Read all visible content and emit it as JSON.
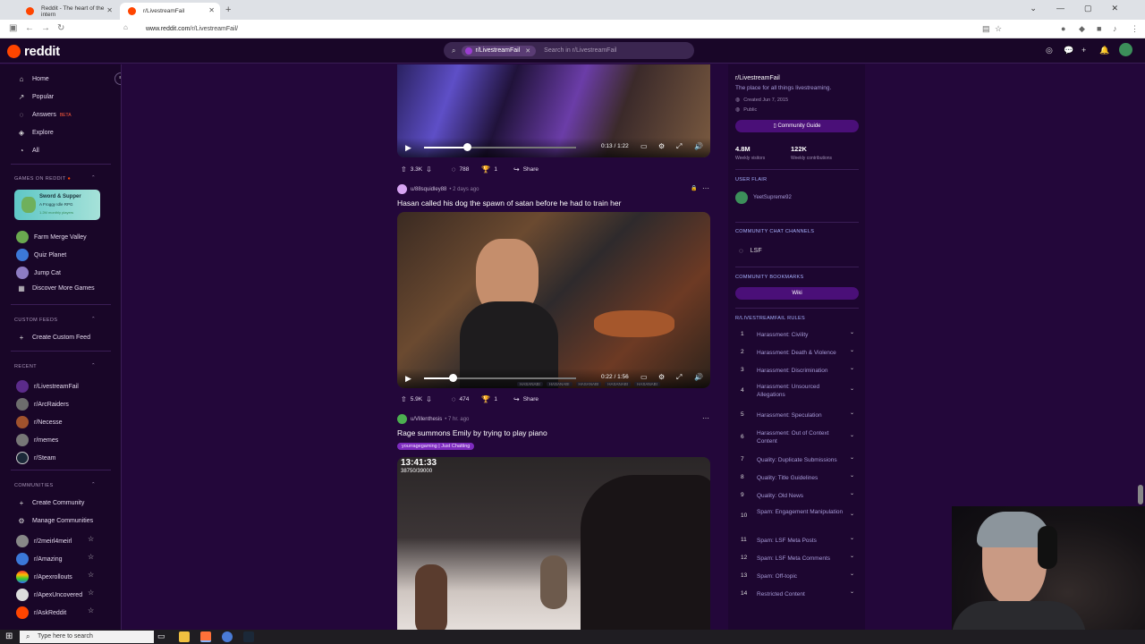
{
  "browser": {
    "tabs": [
      {
        "title": "Reddit - The heart of the intern",
        "active": false
      },
      {
        "title": "r/LivestreamFail",
        "active": true
      }
    ],
    "url_domain": "www.reddit.com",
    "url_path": "/r/LivestreamFail/"
  },
  "header": {
    "logo_text": "reddit",
    "search_chip": "r/LivestreamFail",
    "search_placeholder": "Search in r/LivestreamFail",
    "colors": {
      "accent": "#ff4500",
      "background": "#190628"
    }
  },
  "leftnav": {
    "primary": [
      {
        "label": "Home",
        "icon": "home-icon"
      },
      {
        "label": "Popular",
        "icon": "popular-icon"
      },
      {
        "label": "Answers",
        "icon": "answers-icon",
        "badge": "BETA"
      },
      {
        "label": "Explore",
        "icon": "explore-icon"
      },
      {
        "label": "All",
        "icon": "all-icon"
      }
    ],
    "games_header": "GAMES ON REDDIT",
    "game_card": {
      "title": "Sword & Supper",
      "subtitle": "A Froggy Idle RPG",
      "meta": "1.2M monthly players"
    },
    "games": [
      "Farm Merge Valley",
      "Quiz Planet",
      "Jump Cat",
      "Discover More Games"
    ],
    "custom_feeds_header": "CUSTOM FEEDS",
    "create_custom_feed": "Create Custom Feed",
    "recent_header": "RECENT",
    "recent": [
      "r/LivestreamFail",
      "r/ArcRaiders",
      "r/Necesse",
      "r/memes",
      "r/Steam"
    ],
    "communities_header": "COMMUNITIES",
    "create_community": "Create Community",
    "manage_communities": "Manage Communities",
    "communities": [
      "r/2meirl4meirl",
      "r/Amazing",
      "r/Apexrollouts",
      "r/ApexUncovered",
      "r/AskReddit"
    ]
  },
  "feed": {
    "post1": {
      "time": "0:13 / 1:22",
      "progress": 0.28,
      "votes": "3.3K",
      "comments": "788",
      "awards": "1",
      "share": "Share"
    },
    "post2": {
      "author": "u/88squidley88",
      "ago": "• 2 days ago",
      "title": "Hasan called his dog the spawn of satan before he had to train her",
      "time": "0:22 / 1:56",
      "progress": 0.19,
      "votes": "5.9K",
      "comments": "474",
      "awards": "1",
      "share": "Share"
    },
    "post3": {
      "author": "u/Villenthesis",
      "ago": "• 7 hr. ago",
      "title": "Rage summons Emily by trying to play piano",
      "flair": "yourragegaming | Just Chatting",
      "overlay_time": "13:41:33",
      "overlay_sub": "38750/39000"
    }
  },
  "rightbar": {
    "name": "r/LivestreamFail",
    "description": "The place for all things livestreaming.",
    "created": "Created Jun 7, 2015",
    "visibility": "Public",
    "guide_button": "Community Guide",
    "visitors": "4.8M",
    "visitors_label": "Weekly visitors",
    "contributions": "122K",
    "contributions_label": "Weekly contributions",
    "user_flair_header": "USER FLAIR",
    "user_flair_name": "YeetSupreme92",
    "chat_header": "COMMUNITY CHAT CHANNELS",
    "chat_channel": "LSF",
    "bookmarks_header": "COMMUNITY BOOKMARKS",
    "bookmark": "Wiki",
    "rules_header": "R/LIVESTREAMFAIL RULES",
    "rules": [
      {
        "n": "1",
        "t": "Harassment: Civility"
      },
      {
        "n": "2",
        "t": "Harassment: Death & Violence"
      },
      {
        "n": "3",
        "t": "Harassment: Discrimination"
      },
      {
        "n": "4",
        "t": "Harassment: Unsourced Allegations"
      },
      {
        "n": "5",
        "t": "Harassment: Speculation"
      },
      {
        "n": "6",
        "t": "Harassment: Out of Context Content"
      },
      {
        "n": "7",
        "t": "Quality: Duplicate Submissions"
      },
      {
        "n": "8",
        "t": "Quality: Title Guidelines"
      },
      {
        "n": "9",
        "t": "Quality: Old News"
      },
      {
        "n": "10",
        "t": "Spam: Engagement Manipulation"
      },
      {
        "n": "11",
        "t": "Spam: LSF Meta Posts"
      },
      {
        "n": "12",
        "t": "Spam: LSF Meta Comments"
      },
      {
        "n": "13",
        "t": "Spam: Off-topic"
      },
      {
        "n": "14",
        "t": "Restricted Content"
      }
    ]
  },
  "taskbar": {
    "search_placeholder": "Type here to search"
  }
}
